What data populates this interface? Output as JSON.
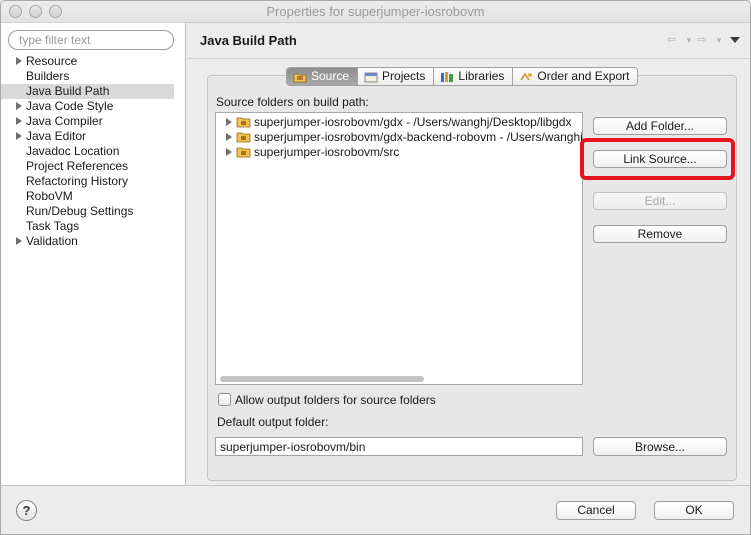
{
  "window": {
    "title": "Properties for superjumper-iosrobovm"
  },
  "sidebar": {
    "filter_placeholder": "type filter text",
    "items": [
      {
        "label": "Resource",
        "expandable": true
      },
      {
        "label": "Builders",
        "expandable": false
      },
      {
        "label": "Java Build Path",
        "expandable": false,
        "selected": true
      },
      {
        "label": "Java Code Style",
        "expandable": true
      },
      {
        "label": "Java Compiler",
        "expandable": true
      },
      {
        "label": "Java Editor",
        "expandable": true
      },
      {
        "label": "Javadoc Location",
        "expandable": false
      },
      {
        "label": "Project References",
        "expandable": false
      },
      {
        "label": "Refactoring History",
        "expandable": false
      },
      {
        "label": "RoboVM",
        "expandable": false
      },
      {
        "label": "Run/Debug Settings",
        "expandable": false
      },
      {
        "label": "Task Tags",
        "expandable": false
      },
      {
        "label": "Validation",
        "expandable": true
      }
    ]
  },
  "page": {
    "title": "Java Build Path"
  },
  "tabs": [
    {
      "label": "Source",
      "icon": "source-folder-icon",
      "active": true
    },
    {
      "label": "Projects",
      "icon": "projects-icon",
      "active": false
    },
    {
      "label": "Libraries",
      "icon": "libraries-icon",
      "active": false
    },
    {
      "label": "Order and Export",
      "icon": "order-export-icon",
      "active": false
    }
  ],
  "source": {
    "list_label": "Source folders on build path:",
    "folders": [
      "superjumper-iosrobovm/gdx - /Users/wanghj/Desktop/libgdx",
      "superjumper-iosrobovm/gdx-backend-robovm - /Users/wanghj",
      "superjumper-iosrobovm/src"
    ],
    "buttons": {
      "add_folder": "Add Folder...",
      "link_source": "Link Source...",
      "edit": "Edit...",
      "remove": "Remove",
      "browse": "Browse..."
    },
    "allow_output_label": "Allow output folders for source folders",
    "allow_output_checked": false,
    "default_output_label": "Default output folder:",
    "default_output_value": "superjumper-iosrobovm/bin"
  },
  "dialog": {
    "help": "?",
    "cancel": "Cancel",
    "ok": "OK"
  },
  "colors": {
    "highlight": "#e8121b",
    "selection": "#d9d9d9",
    "active_tab": "#9a9a9a"
  }
}
